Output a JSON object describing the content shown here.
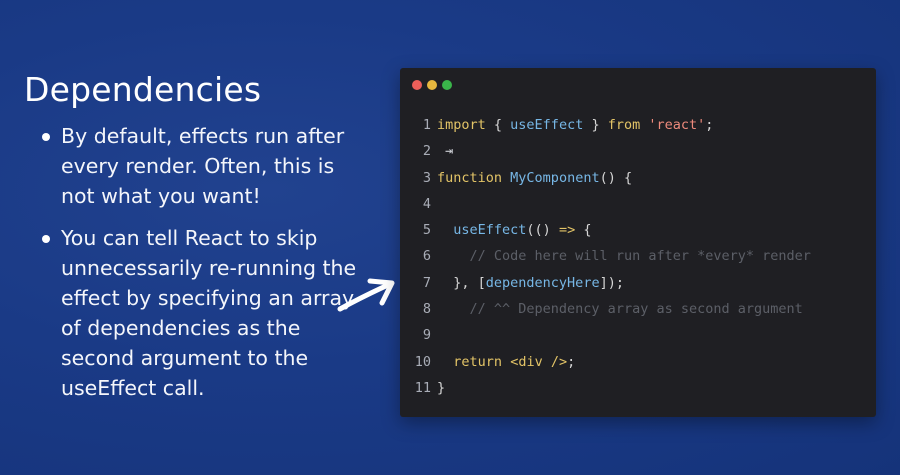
{
  "slide": {
    "title": "Dependencies",
    "bullets": [
      "By default, effects run after every render. Often, this is not what you want!",
      "You can tell React to skip unnecessarily re-running the effect by specifying an array of dependencies as the second argument to the useEffect call."
    ]
  },
  "icons": {
    "pointer": "arrow-right-icon",
    "window_controls": [
      "close-dot-icon",
      "minimize-dot-icon",
      "maximize-dot-icon"
    ]
  },
  "colors": {
    "background": "#1a3a86",
    "editor_bg": "#1f1f23",
    "dot_red": "#ec5f5a",
    "dot_yellow": "#e6b73e",
    "dot_green": "#3ab54a"
  },
  "code": {
    "line_numbers": [
      "1",
      "2",
      "3",
      "4",
      "5",
      "6",
      "7",
      "8",
      "9",
      "10",
      "11"
    ],
    "l1": {
      "kw1": "import",
      "t1": " { ",
      "fn": "useEffect",
      "t2": " } ",
      "kw2": "from",
      "t3": " ",
      "str": "'react'",
      "t4": ";"
    },
    "l2": {
      "mark": "⇥"
    },
    "l3": {
      "kw": "function",
      "t1": " ",
      "fn": "MyComponent",
      "t2": "() {"
    },
    "l5": {
      "indent": "  ",
      "fn": "useEffect",
      "t1": "(() ",
      "op": "=>",
      "t2": " {"
    },
    "l6": {
      "indent": "    ",
      "cm": "// Code here will run after *every* render"
    },
    "l7": {
      "t1": "  }, [",
      "fn": "dependencyHere",
      "t2": "]);"
    },
    "l8": {
      "indent": "    ",
      "cm": "// ^^ Dependency array as second argument"
    },
    "l10": {
      "indent": "  ",
      "kw": "return",
      "t1": " ",
      "tag": "<div />",
      "t2": ";"
    },
    "l11": {
      "t1": "}"
    }
  }
}
